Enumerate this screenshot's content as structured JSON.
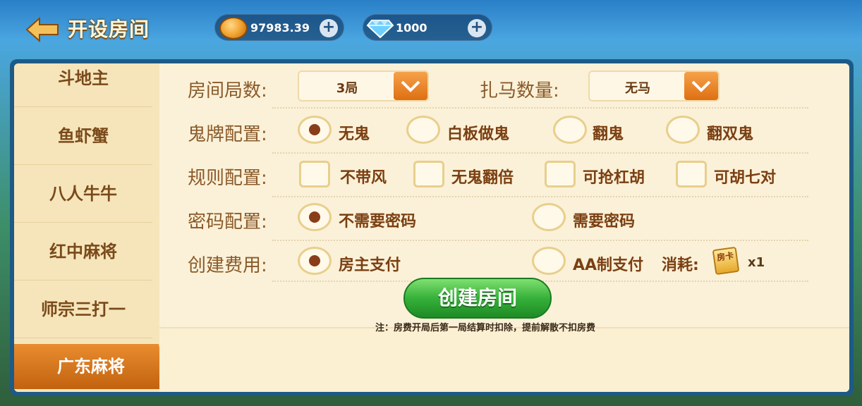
{
  "header": {
    "title": "开设房间",
    "gold_amount": "97983.39",
    "gem_amount": "1000",
    "plus_symbol": "+"
  },
  "sidebar": {
    "items": [
      {
        "label": "斗地主"
      },
      {
        "label": "鱼虾蟹"
      },
      {
        "label": "八人牛牛"
      },
      {
        "label": "红中麻将"
      },
      {
        "label": "师宗三打一"
      },
      {
        "label": "广东麻将"
      }
    ],
    "active": "广东麻将"
  },
  "settings": {
    "rounds": {
      "label": "房间局数:",
      "value": "3局"
    },
    "horses": {
      "label": "扎马数量:",
      "value": "无马"
    },
    "ghost": {
      "label": "鬼牌配置:",
      "options": [
        "无鬼",
        "白板做鬼",
        "翻鬼",
        "翻双鬼"
      ],
      "selected": "无鬼"
    },
    "rules": {
      "label": "规则配置:",
      "options": [
        "不带风",
        "无鬼翻倍",
        "可抢杠胡",
        "可胡七对"
      ]
    },
    "password": {
      "label": "密码配置:",
      "options": [
        "不需要密码",
        "需要密码"
      ],
      "selected": "不需要密码"
    },
    "fee": {
      "label": "创建费用:",
      "options": [
        "房主支付",
        "AA制支付"
      ],
      "selected": "房主支付",
      "consume_label": "消耗:",
      "card_text": "房卡",
      "count": "x1"
    }
  },
  "footer": {
    "create_button": "创建房间",
    "note": "注：房费开局后第一局结算时扣除，提前解散不扣房费"
  },
  "colors": {
    "accent_orange": "#de6f12",
    "button_green": "#36b13a",
    "label_brown": "#8a5a2a",
    "panel_bg": "#fbf1d8"
  }
}
